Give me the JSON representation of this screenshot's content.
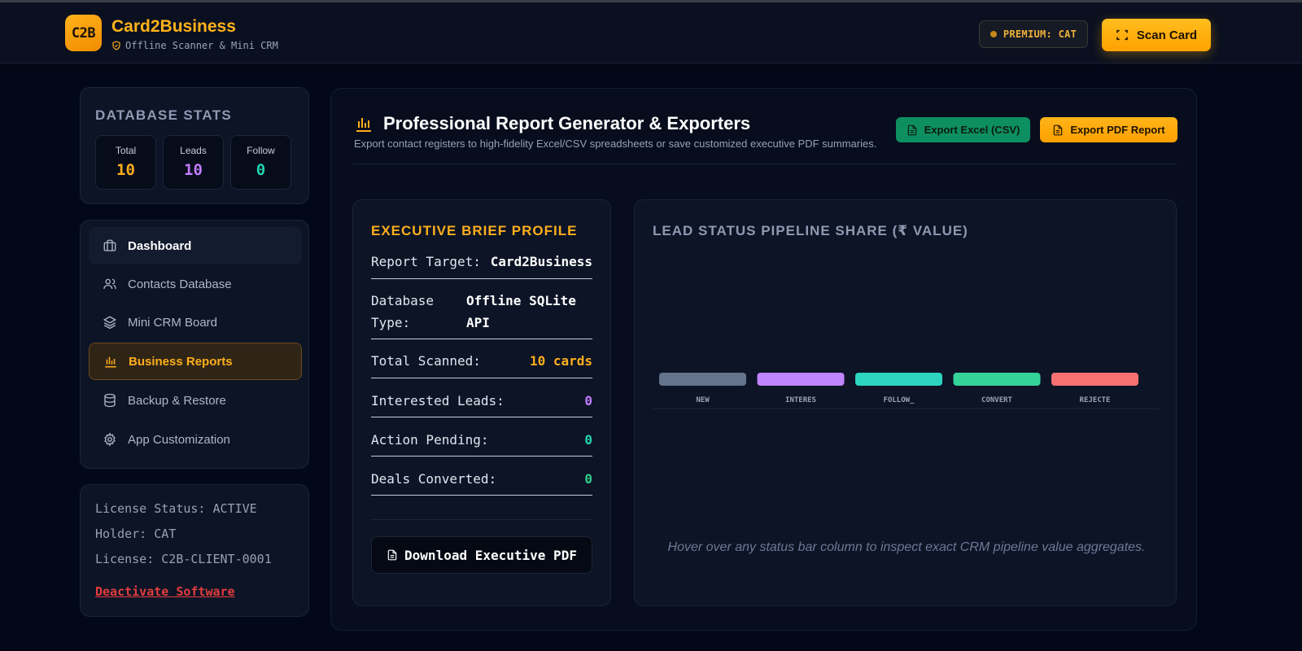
{
  "header": {
    "logo_text": "C2B",
    "brand_title": "Card2Business",
    "brand_subtitle": "Offline Scanner & Mini CRM",
    "premium_label": "PREMIUM: CAT",
    "scan_button": "Scan Card"
  },
  "stats": {
    "title": "DATABASE STATS",
    "items": [
      {
        "label": "Total",
        "value": "10",
        "color": "#ffae1c"
      },
      {
        "label": "Leads",
        "value": "10",
        "color": "#c27bff"
      },
      {
        "label": "Follow",
        "value": "0",
        "color": "#22d3b0"
      }
    ]
  },
  "nav": {
    "items": [
      {
        "label": "Dashboard",
        "icon": "briefcase-icon"
      },
      {
        "label": "Contacts Database",
        "icon": "users-icon"
      },
      {
        "label": "Mini CRM Board",
        "icon": "layers-icon"
      },
      {
        "label": "Business Reports",
        "icon": "bar-chart-icon"
      },
      {
        "label": "Backup & Restore",
        "icon": "database-icon"
      },
      {
        "label": "App Customization",
        "icon": "gear-icon"
      }
    ]
  },
  "license": {
    "status": "License Status: ACTIVE",
    "holder": "Holder: CAT",
    "key": "License: C2B-CLIENT-0001",
    "deactivate": "Deactivate Software"
  },
  "report": {
    "title": "Professional Report Generator & Exporters",
    "subtitle": "Export contact registers to high-fidelity Excel/CSV spreadsheets or save customized executive PDF summaries.",
    "export_excel": "Export Excel (CSV)",
    "export_pdf": "Export PDF Report"
  },
  "brief": {
    "title": "EXECUTIVE BRIEF PROFILE",
    "report_target_label": "Report Target:",
    "report_target_value": "Card2Business",
    "db_type_label_1": "Database",
    "db_type_label_2": "Type:",
    "db_type_value_1": "Offline SQLite",
    "db_type_value_2": "API",
    "total_scanned_label": "Total Scanned:",
    "total_scanned_value": "10 cards",
    "interested_label": "Interested Leads:",
    "interested_value": "0",
    "pending_label": "Action Pending:",
    "pending_value": "0",
    "converted_label": "Deals Converted:",
    "converted_value": "0",
    "download_button": "Download Executive PDF"
  },
  "chart": {
    "title": "LEAD STATUS PIPELINE SHARE (₹ VALUE)",
    "hint": "Hover over any status bar column to inspect exact CRM pipeline value aggregates."
  },
  "chart_data": {
    "type": "bar",
    "title": "LEAD STATUS PIPELINE SHARE (₹ VALUE)",
    "categories": [
      "NEW",
      "INTERES",
      "FOLLOW_",
      "CONVERT",
      "REJECTE"
    ],
    "values": [
      0,
      0,
      0,
      0,
      0
    ],
    "colors": [
      "#64748b",
      "#c084fc",
      "#2dd4bf",
      "#34d399",
      "#f87171"
    ],
    "xlabel": "",
    "ylabel": "",
    "grid": false
  }
}
